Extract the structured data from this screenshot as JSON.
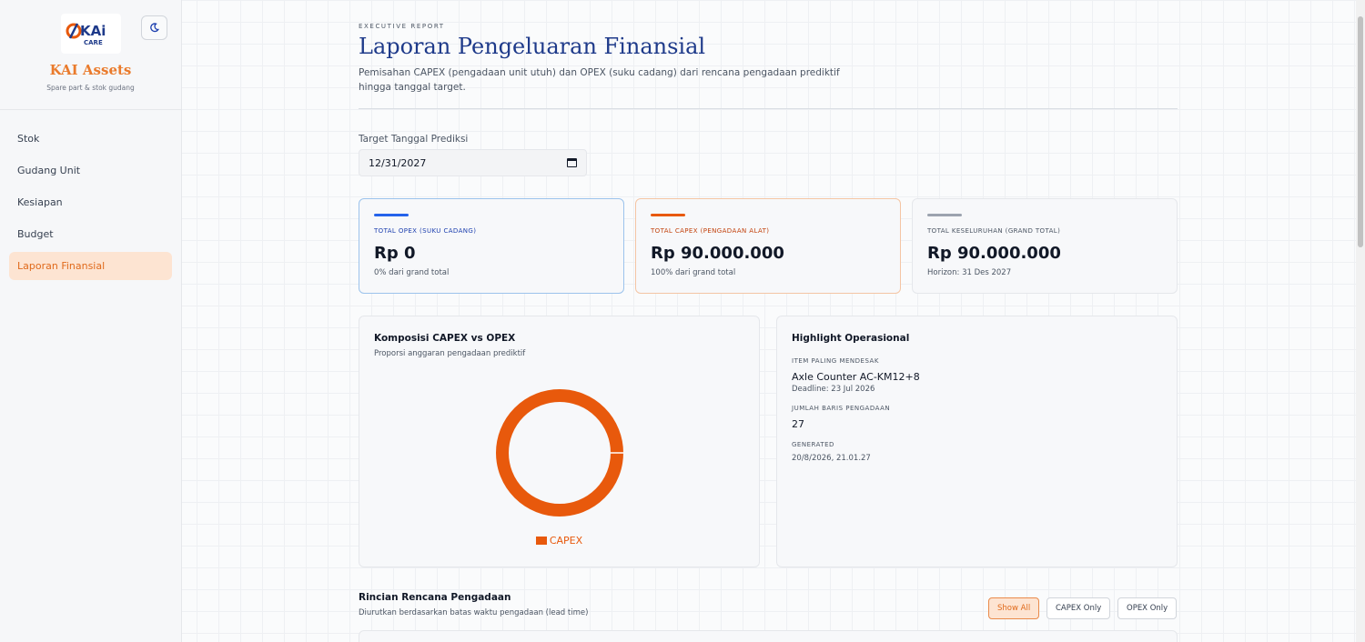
{
  "app": {
    "name": "KAI Assets",
    "subtitle": "Spare part & stok gudang",
    "logo_text": "KAi",
    "logo_sub": "CARE"
  },
  "nav": {
    "items": [
      {
        "label": "Stok",
        "active": false
      },
      {
        "label": "Gudang Unit",
        "active": false
      },
      {
        "label": "Kesiapan",
        "active": false
      },
      {
        "label": "Budget",
        "active": false
      },
      {
        "label": "Laporan Finansial",
        "active": true
      }
    ]
  },
  "header": {
    "eyebrow": "EXECUTIVE REPORT",
    "title": "Laporan Pengeluaran Finansial",
    "description": "Pemisahan CAPEX (pengadaan unit utuh) dan OPEX (suku cadang) dari rencana pengadaan prediktif hingga tanggal target."
  },
  "filter": {
    "date_label": "Target Tanggal Prediksi",
    "date_value": "12/31/2027"
  },
  "stats": {
    "opex": {
      "label": "TOTAL OPEX (SUKU CADANG)",
      "value": "Rp 0",
      "note": "0% dari grand total"
    },
    "capex": {
      "label": "TOTAL CAPEX (PENGADAAN ALAT)",
      "value": "Rp 90.000.000",
      "note": "100% dari grand total"
    },
    "total": {
      "label": "TOTAL KESELURUHAN (GRAND TOTAL)",
      "value": "Rp 90.000.000",
      "note": "Horizon: 31 Des 2027"
    }
  },
  "chart_panel": {
    "title": "Komposisi CAPEX vs OPEX",
    "subtitle": "Proporsi anggaran pengadaan prediktif"
  },
  "chart_data": {
    "type": "pie",
    "donut": true,
    "categories": [
      "CAPEX",
      "OPEX"
    ],
    "values": [
      90000000,
      0
    ],
    "legend_labels": [
      "CAPEX"
    ],
    "colors": [
      "#e8590c",
      "#2563eb"
    ],
    "legend_position": "bottom"
  },
  "highlight": {
    "title": "Highlight Operasional",
    "urgent_label": "ITEM PALING MENDESAK",
    "urgent_item": "Axle Counter AC-KM12+8",
    "urgent_deadline": "Deadline: 23 Jul 2026",
    "rows_label": "JUMLAH BARIS PENGADAAN",
    "rows_value": "27",
    "generated_label": "GENERATED",
    "generated_value": "20/8/2026, 21.01.27"
  },
  "details": {
    "title": "Rincian Rencana Pengadaan",
    "subtitle": "Diurutkan berdasarkan batas waktu pengadaan (lead time)",
    "buttons": [
      "Show All",
      "CAPEX Only",
      "OPEX Only"
    ]
  },
  "colors": {
    "accent": "#ea7b2c",
    "opex": "#2563eb",
    "capex": "#e8590c",
    "total": "#9ca3af",
    "title": "#1e3a8a"
  }
}
